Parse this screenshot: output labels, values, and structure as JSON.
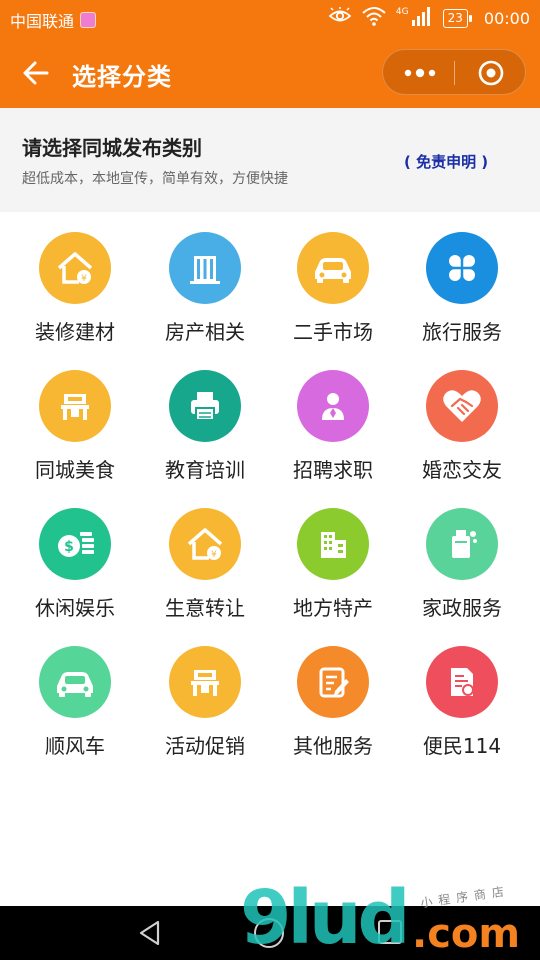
{
  "status_bar": {
    "carrier": "中国联通",
    "network": "4G",
    "battery": "23",
    "time": "00:00"
  },
  "nav": {
    "title": "选择分类"
  },
  "header": {
    "title": "请选择同城发布类别",
    "subtitle": "超低成本，本地宣传，简单有效，方便快捷",
    "disclaimer": "( 免责申明 )"
  },
  "categories": [
    {
      "label": "装修建材",
      "color": "#f7b733",
      "icon": "house-coin-icon"
    },
    {
      "label": "房产相关",
      "color": "#4aaee6",
      "icon": "building-icon"
    },
    {
      "label": "二手市场",
      "color": "#f7b733",
      "icon": "car-icon"
    },
    {
      "label": "旅行服务",
      "color": "#1a8fe0",
      "icon": "clover-icon"
    },
    {
      "label": "同城美食",
      "color": "#f7b733",
      "icon": "table-icon"
    },
    {
      "label": "教育培训",
      "color": "#17a78c",
      "icon": "printer-icon"
    },
    {
      "label": "招聘求职",
      "color": "#d86ae0",
      "icon": "person-icon"
    },
    {
      "label": "婚恋交友",
      "color": "#f26b4f",
      "icon": "heart-handshake-icon"
    },
    {
      "label": "休闲娱乐",
      "color": "#22c28e",
      "icon": "money-icon"
    },
    {
      "label": "生意转让",
      "color": "#f7b733",
      "icon": "house-coin-icon"
    },
    {
      "label": "地方特产",
      "color": "#8ccb2d",
      "icon": "factory-icon"
    },
    {
      "label": "家政服务",
      "color": "#5ad39a",
      "icon": "cleaning-icon"
    },
    {
      "label": "顺风车",
      "color": "#55d597",
      "icon": "car-icon"
    },
    {
      "label": "活动促销",
      "color": "#f7b733",
      "icon": "table-icon"
    },
    {
      "label": "其他服务",
      "color": "#f58a2a",
      "icon": "edit-icon"
    },
    {
      "label": "便民114",
      "color": "#ef4f5d",
      "icon": "certificate-icon"
    }
  ],
  "watermark": {
    "digits": "9lud",
    "domain": ".com",
    "small_text": "小程序商店"
  }
}
